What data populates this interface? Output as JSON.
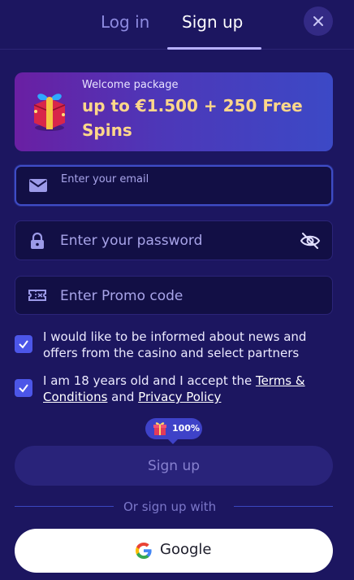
{
  "tabs": {
    "login_label": "Log in",
    "signup_label": "Sign up"
  },
  "icons": {
    "close": "close-icon",
    "email": "envelope-icon",
    "password": "lock-icon",
    "promo": "ticket-icon",
    "toggle_visibility": "eye-off-icon",
    "check": "checkmark-icon",
    "gift": "gift-icon",
    "google": "google-logo-icon"
  },
  "banner": {
    "subtitle": "Welcome package",
    "headline": "up to €1.500 + 250 Free Spins"
  },
  "form": {
    "email_placeholder": "Enter your email",
    "password_placeholder": "Enter your password",
    "promo_placeholder": "Enter Promo code",
    "newsletter_checked": true,
    "newsletter_text": "I would like to be informed about news and offers from the casino and select partners",
    "age_checked": true,
    "age_text_prefix": "I am 18 years old and I accept the ",
    "terms_link": "Terms & Conditions",
    "age_text_and": " and ",
    "privacy_link": "Privacy Policy",
    "badge_text": "100%",
    "submit_label": "Sign up"
  },
  "social": {
    "divider_text": "Or sign up with",
    "google_label": "Google"
  },
  "colors": {
    "background": "#1c1660",
    "accent": "#4c56e8",
    "banner_headline": "#ffd78a"
  }
}
